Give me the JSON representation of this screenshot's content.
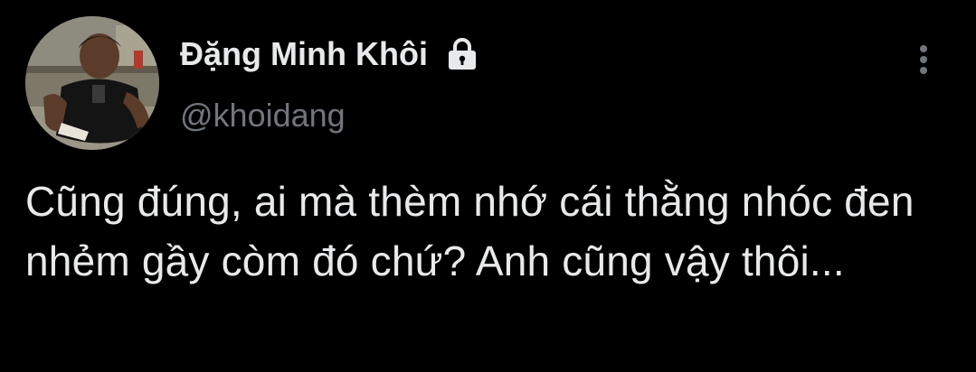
{
  "author": {
    "display_name": "Đặng Minh Khôi",
    "handle": "@khoidang",
    "protected_icon": "lock-icon",
    "avatar": "avatar-photo"
  },
  "actions": {
    "more_icon": "more-vertical-icon"
  },
  "tweet": {
    "text": "Cũng đúng, ai mà thèm nhớ cái thằng nhóc đen nhẻm gầy còm đó chứ? Anh cũng vậy thôi..."
  },
  "colors": {
    "background": "#000000",
    "primary_text": "#e7e9ea",
    "secondary_text": "#71767b"
  }
}
